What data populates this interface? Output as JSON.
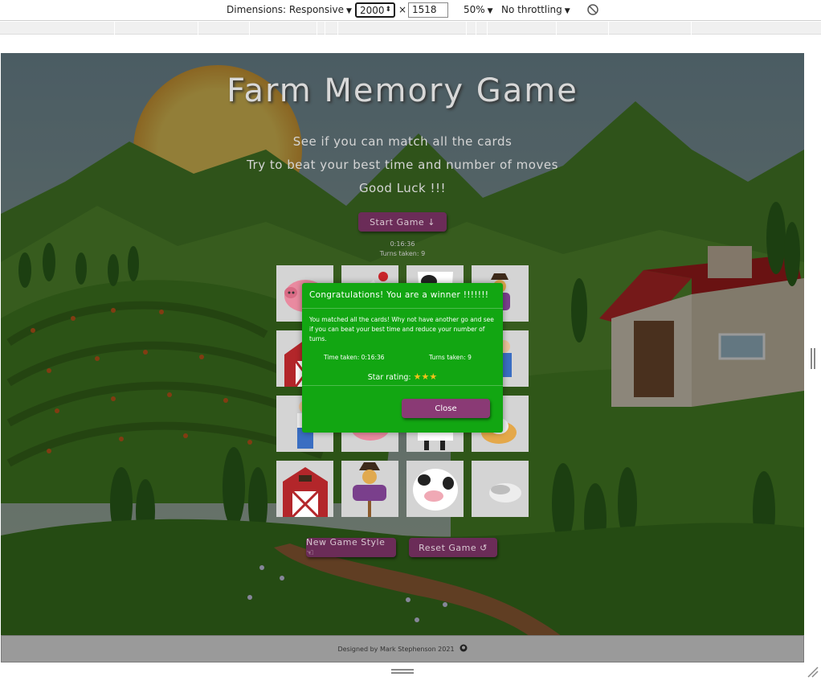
{
  "devtools": {
    "dimensions_label": "Dimensions: Responsive",
    "width_value": "2000",
    "times": "×",
    "height_value": "1518",
    "zoom": "50%",
    "throttling": "No throttling",
    "caret": "▼",
    "spinner": "⬍",
    "rotate_icon": "rotate-icon"
  },
  "game": {
    "title": "Farm Memory Game",
    "subtitle_lines": [
      "See if you can match all the cards",
      "Try to beat your best time and number of moves",
      "Good Luck !!!"
    ],
    "start_button": "Start Game ↓",
    "timer": "0:16:36",
    "turns": "Turns taken: 9",
    "cards": [
      "pig",
      "rooster",
      "cow",
      "scarecrow",
      "barn",
      "",
      "",
      "farmer",
      "farmer",
      "pig",
      "cow",
      "hen",
      "barn",
      "scarecrow",
      "cow",
      "goose"
    ],
    "new_game_style_button": "New Game Style ☜",
    "reset_button": "Reset Game ↺",
    "footer_text": "Designed by Mark Stephenson 2021",
    "footer_icon": "github-icon"
  },
  "modal": {
    "title": "Congratulations! You are a winner !!!!!!!",
    "body": "You matched all the cards! Why not have another go and see if you can beat your best time and reduce your number of turns.",
    "time_taken": "Time taken: 0:16:36",
    "turns_taken": "Turns taken: 9",
    "star_label": "Star rating:",
    "stars": "★★★",
    "star_count": 3,
    "close_button": "Close"
  },
  "colors": {
    "modal_bg": "#12a612",
    "button_bg": "#6b2c58",
    "close_bg": "#8a3a75",
    "star": "#f3c21a"
  }
}
